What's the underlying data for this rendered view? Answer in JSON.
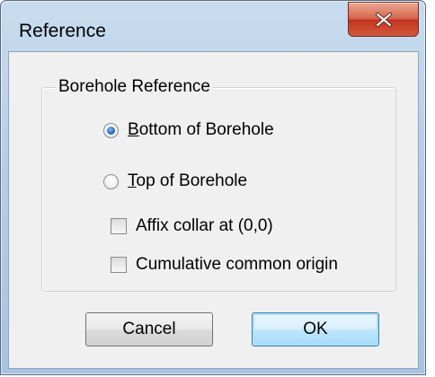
{
  "dialog": {
    "title": "Reference",
    "close_glyph": "X"
  },
  "group": {
    "label": "Borehole Reference",
    "radios": [
      {
        "mnemonic": "B",
        "rest": "ottom of Borehole",
        "checked": true
      },
      {
        "mnemonic": "T",
        "rest": "op of Borehole",
        "checked": false
      }
    ],
    "checkboxes": [
      {
        "label": "Affix collar at (0,0)",
        "checked": false
      },
      {
        "label": "Cumulative common origin",
        "checked": false
      }
    ]
  },
  "buttons": {
    "cancel": "Cancel",
    "ok": "OK"
  },
  "colors": {
    "radio_accent": "#1c5fb8",
    "close_red": "#c3331b",
    "default_button_border": "#3c7fb1"
  },
  "icons": {
    "close": "close-icon"
  }
}
